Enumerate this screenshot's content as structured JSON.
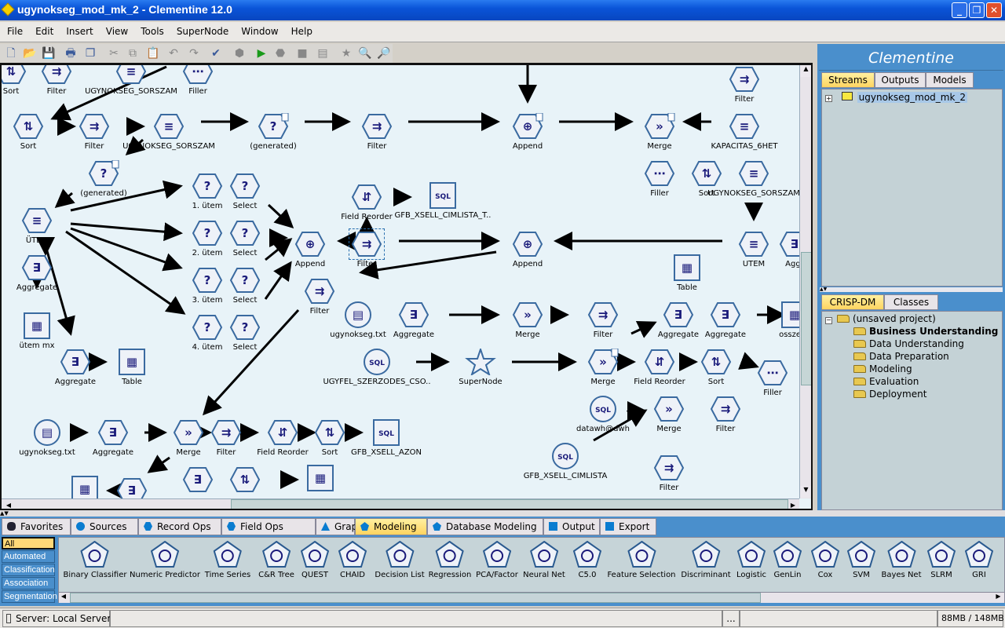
{
  "window": {
    "title": "ugynokseg_mod_mk_2 - Clementine 12.0",
    "controls": [
      "_",
      "❐",
      "✕"
    ]
  },
  "menu": [
    "File",
    "Edit",
    "Insert",
    "View",
    "Tools",
    "SuperNode",
    "Window",
    "Help"
  ],
  "toolbar": [
    "new-file",
    "open-folder",
    "save",
    "print",
    "multi-window",
    "cut",
    "copy",
    "paste",
    "undo",
    "redo",
    "annotate",
    "sql-preview",
    "run",
    "run-selection",
    "stop",
    "preview",
    "supernode-star",
    "zoom-in",
    "zoom-out"
  ],
  "colors": {
    "accent": "#4a8fcc",
    "canvas": "#e8f3f8",
    "node": "#1a1a7a",
    "selected_tab": "#ffd460"
  },
  "canvas": {
    "nodes": [
      {
        "label": "Sort",
        "kind": "sort"
      },
      {
        "label": "Filter",
        "kind": "filter"
      },
      {
        "label": "UGYNOKSEG_SORSZAM",
        "kind": "derive"
      },
      {
        "label": "Filler",
        "kind": "filler"
      },
      {
        "label": "Sort",
        "kind": "sort"
      },
      {
        "label": "Filter",
        "kind": "filter"
      },
      {
        "label": "UGYNOKSEG_SORSZAM",
        "kind": "derive"
      },
      {
        "label": "(generated)",
        "kind": "select"
      },
      {
        "label": "Filter",
        "kind": "filter"
      },
      {
        "label": "Append",
        "kind": "append"
      },
      {
        "label": "Merge",
        "kind": "merge"
      },
      {
        "label": "KAPACITAS_6HET",
        "kind": "derive"
      },
      {
        "label": "Filter",
        "kind": "filter"
      },
      {
        "label": "(generated)",
        "kind": "select"
      },
      {
        "label": "Filler",
        "kind": "filler"
      },
      {
        "label": "Sort",
        "kind": "sort"
      },
      {
        "label": "UGYNOKSEG_SORSZAM",
        "kind": "derive"
      },
      {
        "label": "1. ütem",
        "kind": "select"
      },
      {
        "label": "Select",
        "kind": "select"
      },
      {
        "label": "Field Reorder",
        "kind": "reorder"
      },
      {
        "label": "GFB_XSELL_CIMLISTA_T..",
        "kind": "sqlbox"
      },
      {
        "label": "ÜTEM",
        "kind": "derive"
      },
      {
        "label": "2. ütem",
        "kind": "select"
      },
      {
        "label": "Select",
        "kind": "select"
      },
      {
        "label": "Append",
        "kind": "append"
      },
      {
        "label": "Filter",
        "kind": "filter"
      },
      {
        "label": "Append",
        "kind": "append"
      },
      {
        "label": "UTEM",
        "kind": "derive"
      },
      {
        "label": "Aggr",
        "kind": "aggregate"
      },
      {
        "label": "Aggregate",
        "kind": "aggregate"
      },
      {
        "label": "Table",
        "kind": "table"
      },
      {
        "label": "3. ütem",
        "kind": "select"
      },
      {
        "label": "Select",
        "kind": "select"
      },
      {
        "label": "Filter",
        "kind": "filter"
      },
      {
        "label": "ugynokseg.txt",
        "kind": "file"
      },
      {
        "label": "Aggregate",
        "kind": "aggregate"
      },
      {
        "label": "Merge",
        "kind": "merge"
      },
      {
        "label": "Filter",
        "kind": "filter"
      },
      {
        "label": "Aggregate",
        "kind": "aggregate"
      },
      {
        "label": "Aggregate",
        "kind": "aggregate"
      },
      {
        "label": "osszesit",
        "kind": "table"
      },
      {
        "label": "ütem mx",
        "kind": "table"
      },
      {
        "label": "4. ütem",
        "kind": "select"
      },
      {
        "label": "Select",
        "kind": "select"
      },
      {
        "label": "Aggregate",
        "kind": "aggregate"
      },
      {
        "label": "Table",
        "kind": "table"
      },
      {
        "label": "UGYFEL_SZERZODES_CSO..",
        "kind": "sqlcircle"
      },
      {
        "label": "SuperNode",
        "kind": "star"
      },
      {
        "label": "Merge",
        "kind": "merge"
      },
      {
        "label": "Field Reorder",
        "kind": "reorder"
      },
      {
        "label": "Sort",
        "kind": "sort"
      },
      {
        "label": "Filler",
        "kind": "filler"
      },
      {
        "label": "datawh@dwh",
        "kind": "sqlcircle"
      },
      {
        "label": "Merge",
        "kind": "merge"
      },
      {
        "label": "Filter",
        "kind": "filter"
      },
      {
        "label": "ugynokseg.txt",
        "kind": "file"
      },
      {
        "label": "Aggregate",
        "kind": "aggregate"
      },
      {
        "label": "Merge",
        "kind": "merge"
      },
      {
        "label": "Filter",
        "kind": "filter"
      },
      {
        "label": "Field Reorder",
        "kind": "reorder"
      },
      {
        "label": "Sort",
        "kind": "sort"
      },
      {
        "label": "GFB_XSELL_AZON",
        "kind": "sqlbox"
      },
      {
        "label": "GFB_XSELL_CIMLISTA",
        "kind": "sqlcircle"
      },
      {
        "label": "Filter",
        "kind": "filter"
      },
      {
        "label": "",
        "kind": "table"
      },
      {
        "label": "",
        "kind": "aggregate"
      },
      {
        "label": "",
        "kind": "aggregate"
      },
      {
        "label": "",
        "kind": "sort"
      },
      {
        "label": "",
        "kind": "table"
      }
    ]
  },
  "rightpanel": {
    "brand": "Clementine",
    "tabs": [
      "Streams",
      "Outputs",
      "Models"
    ],
    "selected_tab": "Streams",
    "streams": [
      "ugynokseg_mod_mk_2"
    ],
    "project_tabs": [
      "CRISP-DM",
      "Classes"
    ],
    "project_root": "(unsaved project)",
    "phases": [
      "Business Understanding",
      "Data Understanding",
      "Data Preparation",
      "Modeling",
      "Evaluation",
      "Deployment"
    ],
    "bold_phase": "Business Understanding"
  },
  "palette": {
    "tabs": [
      "Favorites",
      "Sources",
      "Record Ops",
      "Field Ops",
      "Graphs",
      "Modeling",
      "Database Modeling",
      "Output",
      "Export"
    ],
    "selected_tab": "Modeling",
    "categories": [
      "All",
      "Automated",
      "Classification",
      "Association",
      "Segmentation"
    ],
    "selected_category": "All",
    "items": [
      "Binary Classifier",
      "Numeric Predictor",
      "Time Series",
      "C&R Tree",
      "QUEST",
      "CHAID",
      "Decision List",
      "Regression",
      "PCA/Factor",
      "Neural Net",
      "C5.0",
      "Feature Selection",
      "Discriminant",
      "Logistic",
      "GenLin",
      "Cox",
      "SVM",
      "Bayes Net",
      "SLRM",
      "GRI"
    ]
  },
  "status": {
    "server": "Server: Local Server",
    "ellipsis": "...",
    "memory": "88MB / 148MB"
  }
}
